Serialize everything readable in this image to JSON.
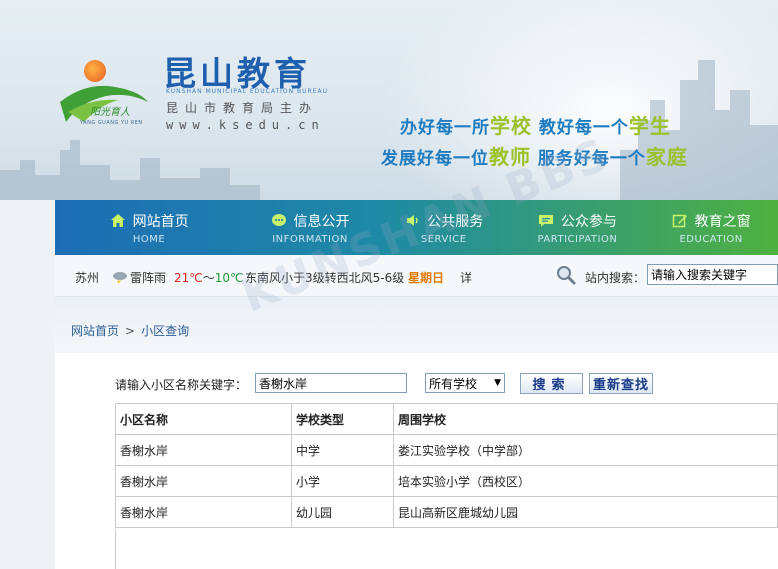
{
  "header": {
    "site_title": "昆山教育",
    "site_title_en": "KUNSHAN MUNICIPAL EDUCATION BUREAU",
    "site_subtitle": "昆山市教育局主办",
    "site_url": "www.ksedu.cn",
    "logo_script": "阳光育人",
    "logo_caption": "YANG GUANG YU REN",
    "slogan1": [
      {
        "text": "办好每一所",
        "hl": false
      },
      {
        "text": "学校",
        "hl": true
      },
      {
        "text": " 教好每一个",
        "hl": false
      },
      {
        "text": "学生",
        "hl": true
      }
    ],
    "slogan2": [
      {
        "text": "发展好每一位",
        "hl": false
      },
      {
        "text": "教师",
        "hl": true
      },
      {
        "text": " 服务好每一个",
        "hl": false
      },
      {
        "text": "家庭",
        "hl": true
      }
    ]
  },
  "nav": {
    "items": [
      {
        "label": "网站首页",
        "en": "HOME",
        "icon": "home-icon"
      },
      {
        "label": "信息公开",
        "en": "INFORMATION",
        "icon": "chat-bubble-icon"
      },
      {
        "label": "公共服务",
        "en": "SERVICE",
        "icon": "speaker-icon"
      },
      {
        "label": "公众参与",
        "en": "PARTICIPATION",
        "icon": "message-icon"
      },
      {
        "label": "教育之窗",
        "en": "EDUCATION",
        "icon": "edit-icon"
      }
    ]
  },
  "infobar": {
    "city": "苏州",
    "weather": "雷阵雨",
    "temp_high": "21℃",
    "temp_sep": "～",
    "temp_low": "10℃",
    "wind": "东南风小于3级转西北风5-6级",
    "day": "星期日",
    "more": "详",
    "search_label": "站内搜索：",
    "search_value": "请输入搜索关键字"
  },
  "breadcrumb": {
    "home": "网站首页",
    "sep": ">",
    "current": "小区查询"
  },
  "query": {
    "label": "请输入小区名称关键字：",
    "value": "香榭水岸",
    "select_value": "所有学校",
    "search_btn": "搜索",
    "reset_btn": "重新查找"
  },
  "table": {
    "headers": [
      "小区名称",
      "学校类型",
      "周围学校"
    ],
    "rows": [
      [
        "香榭水岸",
        "中学",
        "娄江实验学校（中学部）"
      ],
      [
        "香榭水岸",
        "小学",
        "培本实验小学（西校区）"
      ],
      [
        "香榭水岸",
        "幼儿园",
        "昆山高新区鹿城幼儿园"
      ]
    ]
  },
  "colors": {
    "brand_blue": "#1e5fae",
    "accent_green": "#9bc22b",
    "temp_high": "#e0261b",
    "temp_low": "#1d9a3a",
    "day": "#e07b00"
  },
  "watermark": "KUNSHAN BBS"
}
